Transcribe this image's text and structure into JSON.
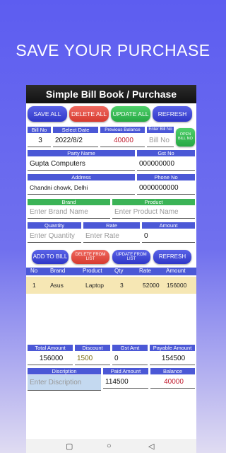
{
  "headline": "SAVE YOUR PURCHASE",
  "app_title": "Simple Bill Book / Purchase",
  "top_buttons": {
    "save_all": "SAVE ALL",
    "delete_all": "DELETE ALL",
    "update_all": "UPDATE ALL",
    "refresh": "REFRESH"
  },
  "bill": {
    "bill_no_label": "Bill No",
    "bill_no": "3",
    "date_label": "Select Date",
    "date": "2022/8/2",
    "prev_balance_label": "Previous Balance",
    "prev_balance": "40000",
    "enter_bill_no_label": "Enter Bill No",
    "enter_bill_no_placeholder": "Bill No",
    "open_bill_no": "OPEN BILL NO"
  },
  "party": {
    "name_label": "Party Name",
    "name": "Gupta Computers",
    "gst_label": "Gst No",
    "gst": "000000000",
    "address_label": "Address",
    "address": "Chandni chowk, Delhi",
    "phone_label": "Phone No",
    "phone": "0000000000"
  },
  "item": {
    "brand_label": "Brand",
    "brand_placeholder": "Enter Brand Name",
    "product_label": "Product",
    "product_placeholder": "Enter Product Name",
    "qty_label": "Quantity",
    "qty_placeholder": "Enter Quantity",
    "rate_label": "Rate",
    "rate_placeholder": "Enter Rate",
    "amount_label": "Amount",
    "amount": "0"
  },
  "list_buttons": {
    "add": "ADD TO BILL",
    "delete": "DELETE FROM LIST",
    "update": "UPDATE FROM LIST",
    "refresh": "REFRESH"
  },
  "table": {
    "headers": [
      "No",
      "Brand",
      "Product",
      "Qty",
      "Rate",
      "Amount"
    ],
    "rows": [
      [
        "1",
        "Asus",
        "Laptop",
        "3",
        "52000",
        "156000"
      ]
    ]
  },
  "totals": {
    "total_label": "Total Amount",
    "total": "156000",
    "discount_label": "Discount",
    "discount": "1500",
    "gst_label": "Gst Amt",
    "gst": "0",
    "payable_label": "Payable Amount",
    "payable": "154500",
    "desc_label": "Discription",
    "desc_placeholder": "Enter Discription",
    "paid_label": "Paid Amount",
    "paid": "114500",
    "balance_label": "Balance",
    "balance": "40000"
  },
  "nav": {
    "recents": "▢",
    "home": "○",
    "back": "◁"
  }
}
